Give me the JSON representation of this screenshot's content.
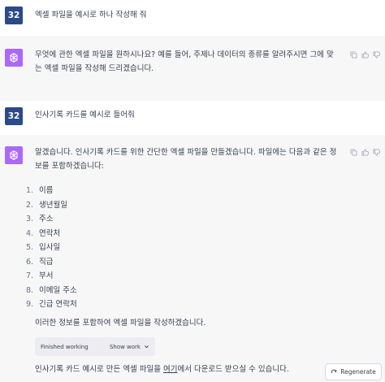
{
  "messages": [
    {
      "role": "user",
      "avatar_label": "32",
      "text": "엑셀 파일을 예시로 하나 작성해 줘"
    },
    {
      "role": "assistant",
      "text_line1": "무엇에 관한 엑셀 파일을 원하시나요? 예를 들어, 주제나 데이터의 종류를 알려주시면 그에 맞",
      "text_line2": "는 엑셀 파일을 작성해 드리겠습니다."
    },
    {
      "role": "user",
      "avatar_label": "32",
      "text": "인사기록 카드를 예시로 들어줘"
    },
    {
      "role": "assistant",
      "intro_line1": "알겠습니다. 인사기록 카드를 위한 간단한 엑셀 파일을 만들겠습니다. 파일에는 다음과 같은 정",
      "intro_line2": "보를 포함하겠습니다:",
      "items": [
        {
          "num": "1.",
          "label": "이름"
        },
        {
          "num": "2.",
          "label": "생년월일"
        },
        {
          "num": "3.",
          "label": "주소"
        },
        {
          "num": "4.",
          "label": "연락처"
        },
        {
          "num": "5.",
          "label": "입사일"
        },
        {
          "num": "6.",
          "label": "직급"
        },
        {
          "num": "7.",
          "label": "부서"
        },
        {
          "num": "8.",
          "label": "이메일 주소"
        },
        {
          "num": "9.",
          "label": "긴급 연락처"
        }
      ],
      "closing": "이러한 정보를 포함하여 엑셀 파일을 작성하겠습니다.",
      "work_status": "Finished working",
      "show_work_label": "Show work",
      "download_prefix": "인사기록 카드 예시로 만든 엑셀 파일을 ",
      "download_link": "여기",
      "download_suffix": "에서 다운로드 받으실 수 있습니다."
    }
  ],
  "regenerate_label": "Regenerate",
  "colors": {
    "user_avatar": "#2b4a8a",
    "assistant_avatar": "#ab68ff",
    "assistant_bg": "#f7f7f8"
  }
}
